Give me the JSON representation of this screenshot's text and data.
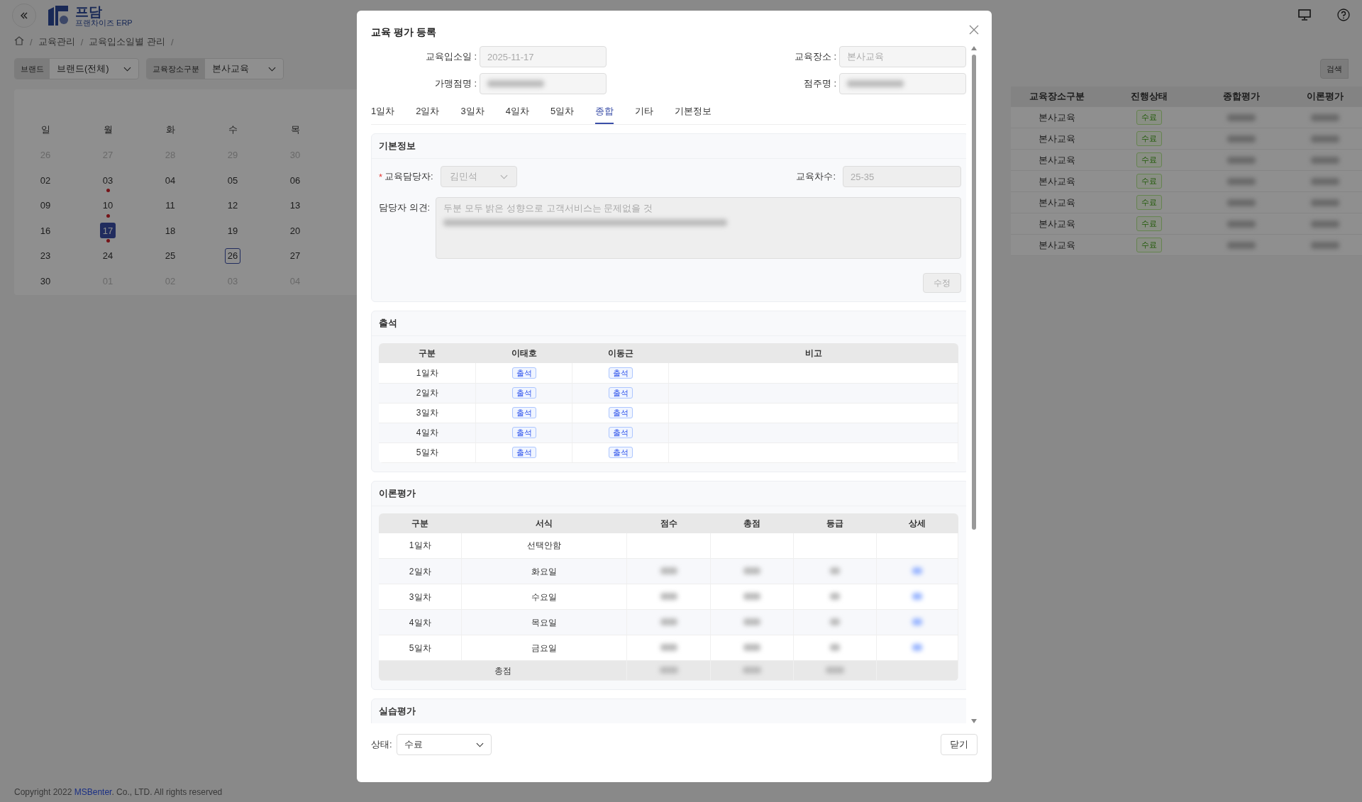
{
  "app": {
    "logo_title": "프담",
    "logo_subtitle": "프랜차이즈 ERP"
  },
  "breadcrumb": [
    {
      "kind": "separator",
      "text": "/"
    },
    {
      "kind": "link",
      "text": "교육관리"
    },
    {
      "kind": "separator",
      "text": "/"
    },
    {
      "kind": "link",
      "text": "교육입소일별 관리"
    },
    {
      "kind": "separator",
      "text": "/"
    }
  ],
  "filters": [
    {
      "label": "브랜드",
      "value": "브랜드(전체)"
    },
    {
      "label": "교육장소구분",
      "value": "본사교육"
    }
  ],
  "search_button": "검색",
  "calendar": {
    "weekdays": [
      "일",
      "월",
      "화",
      "수",
      "목"
    ],
    "weeks": [
      [
        {
          "day": "26",
          "muted": true,
          "event": false,
          "selected": false,
          "today": false
        },
        {
          "day": "27",
          "muted": true,
          "event": false,
          "selected": false,
          "today": false
        },
        {
          "day": "28",
          "muted": true,
          "event": false,
          "selected": false,
          "today": false
        },
        {
          "day": "29",
          "muted": true,
          "event": false,
          "selected": false,
          "today": false
        },
        {
          "day": "30",
          "muted": true,
          "event": false,
          "selected": false,
          "today": false
        }
      ],
      [
        {
          "day": "02",
          "muted": false,
          "event": false,
          "selected": false,
          "today": false
        },
        {
          "day": "03",
          "muted": false,
          "event": true,
          "selected": false,
          "today": false
        },
        {
          "day": "04",
          "muted": false,
          "event": false,
          "selected": false,
          "today": false
        },
        {
          "day": "05",
          "muted": false,
          "event": false,
          "selected": false,
          "today": false
        },
        {
          "day": "06",
          "muted": false,
          "event": false,
          "selected": false,
          "today": false
        }
      ],
      [
        {
          "day": "09",
          "muted": false,
          "event": false,
          "selected": false,
          "today": false
        },
        {
          "day": "10",
          "muted": false,
          "event": true,
          "selected": false,
          "today": false
        },
        {
          "day": "11",
          "muted": false,
          "event": false,
          "selected": false,
          "today": false
        },
        {
          "day": "12",
          "muted": false,
          "event": false,
          "selected": false,
          "today": false
        },
        {
          "day": "13",
          "muted": false,
          "event": false,
          "selected": false,
          "today": false
        }
      ],
      [
        {
          "day": "16",
          "muted": false,
          "event": false,
          "selected": false,
          "today": false
        },
        {
          "day": "17",
          "muted": false,
          "event": true,
          "selected": true,
          "today": false
        },
        {
          "day": "18",
          "muted": false,
          "event": false,
          "selected": false,
          "today": false
        },
        {
          "day": "19",
          "muted": false,
          "event": false,
          "selected": false,
          "today": false
        },
        {
          "day": "20",
          "muted": false,
          "event": false,
          "selected": false,
          "today": false
        }
      ],
      [
        {
          "day": "23",
          "muted": false,
          "event": false,
          "selected": false,
          "today": false
        },
        {
          "day": "24",
          "muted": false,
          "event": false,
          "selected": false,
          "today": false
        },
        {
          "day": "25",
          "muted": false,
          "event": false,
          "selected": false,
          "today": false
        },
        {
          "day": "26",
          "muted": false,
          "event": false,
          "selected": false,
          "today": true
        },
        {
          "day": "27",
          "muted": false,
          "event": false,
          "selected": false,
          "today": false
        }
      ],
      [
        {
          "day": "30",
          "muted": false,
          "event": false,
          "selected": false,
          "today": false
        },
        {
          "day": "01",
          "muted": true,
          "event": false,
          "selected": false,
          "today": false
        },
        {
          "day": "02",
          "muted": true,
          "event": false,
          "selected": false,
          "today": false
        },
        {
          "day": "03",
          "muted": true,
          "event": false,
          "selected": false,
          "today": false
        },
        {
          "day": "04",
          "muted": true,
          "event": false,
          "selected": false,
          "today": false
        }
      ]
    ]
  },
  "table": {
    "columns": [
      "교육장소구분",
      "진행상태",
      "종합평가",
      "이론평가"
    ],
    "rows": [
      {
        "place": "본사교육",
        "status": "수료",
        "redacted": true
      },
      {
        "place": "본사교육",
        "status": "수료",
        "redacted": true
      },
      {
        "place": "본사교육",
        "status": "수료",
        "redacted": true
      },
      {
        "place": "본사교육",
        "status": "수료",
        "redacted": true
      },
      {
        "place": "본사교육",
        "status": "수료",
        "redacted": true
      },
      {
        "place": "본사교육",
        "status": "수료",
        "redacted": true
      },
      {
        "place": "본사교육",
        "status": "수료",
        "redacted": true
      }
    ]
  },
  "footer": {
    "prefix": "Copyright 2022 ",
    "link": "MSBenter",
    "suffix": ". Co., LTD. All rights reserved"
  },
  "modal": {
    "title": "교육 평가 등록",
    "fields": [
      {
        "label": "교육입소일 :",
        "value": "2025-11-17",
        "redacted": false
      },
      {
        "label": "교육장소 :",
        "value": "본사교육",
        "redacted": false
      },
      {
        "label": "가맹점명 :",
        "redacted": true
      },
      {
        "label": "점주명 :",
        "redacted": true
      }
    ],
    "tabs": [
      {
        "label": "1일차",
        "selected": false
      },
      {
        "label": "2일차",
        "selected": false
      },
      {
        "label": "3일차",
        "selected": false
      },
      {
        "label": "4일차",
        "selected": false
      },
      {
        "label": "5일차",
        "selected": false
      },
      {
        "label": "종합",
        "selected": true
      },
      {
        "label": "기타",
        "selected": false
      },
      {
        "label": "기본정보",
        "selected": false
      }
    ],
    "basic_info": {
      "title": "기본정보",
      "manager": {
        "label": "교육담당자:",
        "required_mark": "*",
        "value": "김민석"
      },
      "session": {
        "label": "교육차수:",
        "value": "25-35"
      },
      "opinion": {
        "label": "담당자 의견:",
        "value": "두분 모두 밝은 성향으로 고객서비스는 문제없을 것",
        "redacted": true
      },
      "edit_button": "수정"
    },
    "attendance": {
      "title": "출석",
      "columns": [
        "구분",
        "이태호",
        "이동근",
        "비고"
      ],
      "rows": [
        {
          "day": "1일차",
          "marks": [
            "출석",
            "출석"
          ]
        },
        {
          "day": "2일차",
          "marks": [
            "출석",
            "출석"
          ]
        },
        {
          "day": "3일차",
          "marks": [
            "출석",
            "출석"
          ]
        },
        {
          "day": "4일차",
          "marks": [
            "출석",
            "출석"
          ]
        },
        {
          "day": "5일차",
          "marks": [
            "출석",
            "출석"
          ]
        }
      ]
    },
    "theory": {
      "title": "이론평가",
      "columns": [
        "구분",
        "서식",
        "점수",
        "총점",
        "등급",
        "상세"
      ],
      "rows": [
        {
          "day": "1일차",
          "form": "선택안함",
          "redacted": false
        },
        {
          "day": "2일차",
          "form": "화요일",
          "redacted": true
        },
        {
          "day": "3일차",
          "form": "수요일",
          "redacted": true
        },
        {
          "day": "4일차",
          "form": "목요일",
          "redacted": true
        },
        {
          "day": "5일차",
          "form": "금요일",
          "redacted": true
        }
      ],
      "total_label": "총점"
    },
    "practice": {
      "title": "실습평가"
    },
    "status": {
      "label": "상태:",
      "value": "수료"
    },
    "close_button": "닫기"
  }
}
